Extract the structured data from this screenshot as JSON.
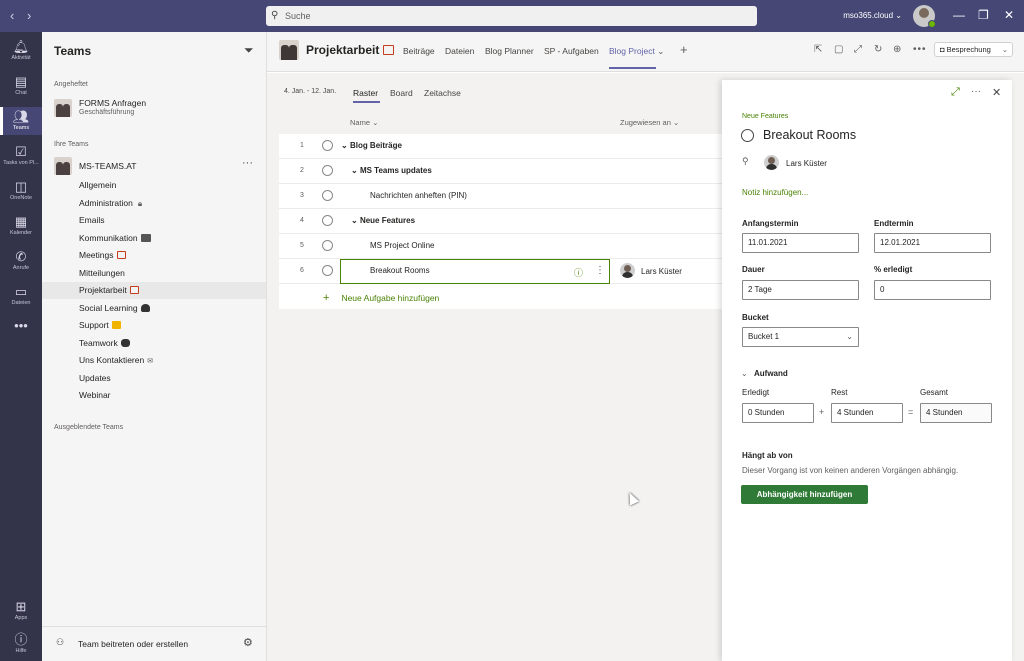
{
  "titlebar": {
    "search_placeholder": "Suche",
    "tenant": "mso365.cloud"
  },
  "rail": [
    {
      "label": "Aktivität",
      "icon": "bell-icon"
    },
    {
      "label": "Chat",
      "icon": "chat-icon"
    },
    {
      "label": "Teams",
      "icon": "teams-icon",
      "active": true
    },
    {
      "label": "Tasks von Pl...",
      "icon": "tasks-icon"
    },
    {
      "label": "OneNote",
      "icon": "onenote-icon"
    },
    {
      "label": "Kalender",
      "icon": "calendar-icon"
    },
    {
      "label": "Anrufe",
      "icon": "phone-icon"
    },
    {
      "label": "Dateien",
      "icon": "files-icon"
    },
    {
      "label": "Apps",
      "icon": "apps-icon"
    },
    {
      "label": "Hilfe",
      "icon": "help-icon"
    }
  ],
  "teams_panel": {
    "title": "Teams",
    "pinned_header": "Angeheftet",
    "pinned": {
      "name": "FORMS Anfragen",
      "sub": "Geschäftsführung"
    },
    "your_teams_header": "Ihre Teams",
    "team_name": "MS-TEAMS.AT",
    "channels": [
      "Allgemein",
      "Administration",
      "Emails",
      "Kommunikation",
      "Meetings",
      "Mitteilungen",
      "Projektarbeit",
      "Social Learning",
      "Support",
      "Teamwork",
      "Uns Kontaktieren",
      "Updates",
      "Webinar"
    ],
    "hidden_header": "Ausgeblendete Teams",
    "join_label": "Team beitreten oder erstellen"
  },
  "header": {
    "channel_title": "Projektarbeit",
    "tabs": [
      "Beiträge",
      "Dateien",
      "Blog Planner",
      "SP - Aufgaben",
      "Blog Project"
    ],
    "active_tab": "Blog Project",
    "meet_label": "Besprechung"
  },
  "planner": {
    "date_range": "4. Jan. - 12. Jan.",
    "views": [
      "Raster",
      "Board",
      "Zeitachse"
    ],
    "columns": {
      "name": "Name",
      "assigned": "Zugewiesen an"
    },
    "rows": [
      {
        "num": "1",
        "name": "Blog Beiträge",
        "bold": true,
        "level": 0
      },
      {
        "num": "2",
        "name": "MS Teams updates",
        "bold": true,
        "level": 1
      },
      {
        "num": "3",
        "name": "Nachrichten anheften (PIN)",
        "bold": false,
        "level": 2
      },
      {
        "num": "4",
        "name": "Neue Features",
        "bold": true,
        "level": 1
      },
      {
        "num": "5",
        "name": "MS Project Online",
        "bold": false,
        "level": 2
      },
      {
        "num": "6",
        "name": "Breakout Rooms",
        "bold": false,
        "level": 2
      }
    ],
    "assignee": "Lars Küster",
    "add_task": "Neue Aufgabe hinzufügen"
  },
  "detail": {
    "breadcrumb": "Neue Features",
    "title": "Breakout Rooms",
    "assignee": "Lars Küster",
    "note_link": "Notiz hinzufügen...",
    "start_label": "Anfangstermin",
    "start_value": "11.01.2021",
    "end_label": "Endtermin",
    "end_value": "12.01.2021",
    "duration_label": "Dauer",
    "duration_value": "2 Tage",
    "percent_label": "% erledigt",
    "percent_value": "0",
    "bucket_label": "Bucket",
    "bucket_value": "Bucket 1",
    "effort_header": "Aufwand",
    "done_label": "Erledigt",
    "done_value": "0 Stunden",
    "rest_label": "Rest",
    "rest_value": "4 Stunden",
    "total_label": "Gesamt",
    "total_value": "4 Stunden",
    "depends_header": "Hängt ab von",
    "depends_text": "Dieser Vorgang ist von keinen anderen Vorgängen abhängig.",
    "dep_button": "Abhängigkeit hinzufügen"
  },
  "colors": {
    "accent": "#6264a7",
    "titlebar": "#464775",
    "rail": "#33344a",
    "planner_green": "#498205"
  }
}
